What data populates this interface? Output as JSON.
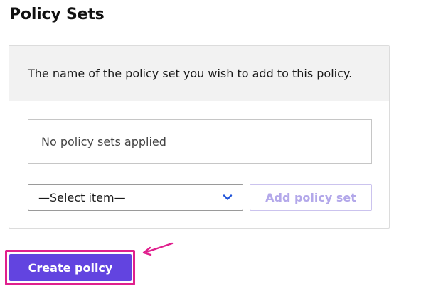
{
  "section": {
    "title": "Policy Sets"
  },
  "card": {
    "description": "The name of the policy set you wish to add to this policy.",
    "applied_empty_text": "No policy sets applied",
    "select": {
      "value": "—Select item—",
      "icon": "chevron-down-icon"
    },
    "add_button_label": "Add policy set"
  },
  "actions": {
    "create_button_label": "Create policy"
  },
  "annotation": {
    "highlight_color": "#e0208e",
    "arrow_icon": "arrow-icon"
  },
  "colors": {
    "accent": "#6244e0",
    "accent_disabled_text": "#b3a8ea",
    "chevron": "#2155d9"
  }
}
